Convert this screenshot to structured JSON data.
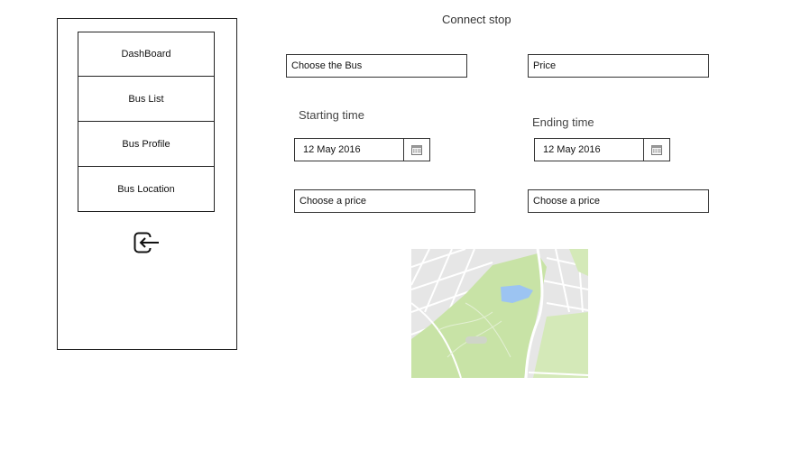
{
  "page": {
    "title": "Connect stop"
  },
  "sidebar": {
    "items": [
      {
        "label": "DashBoard"
      },
      {
        "label": "Bus List"
      },
      {
        "label": "Bus Profile"
      },
      {
        "label": "Bus Location"
      }
    ],
    "logout_icon": "logout-icon"
  },
  "form": {
    "bus_select": "Choose the Bus",
    "price": "Price",
    "start_label": "Starting time",
    "start_date": "12 May 2016",
    "end_label": "Ending time",
    "end_date": "12 May 2016",
    "price_left": "Choose a price",
    "price_right": "Choose a price",
    "calendar_icon": "calendar-icon"
  },
  "map": {
    "icon": "map-image"
  },
  "colors": {
    "park": "#c8e3a6",
    "road_area": "#e8e8e8",
    "water": "#9cc4f2",
    "border": "#222222"
  }
}
